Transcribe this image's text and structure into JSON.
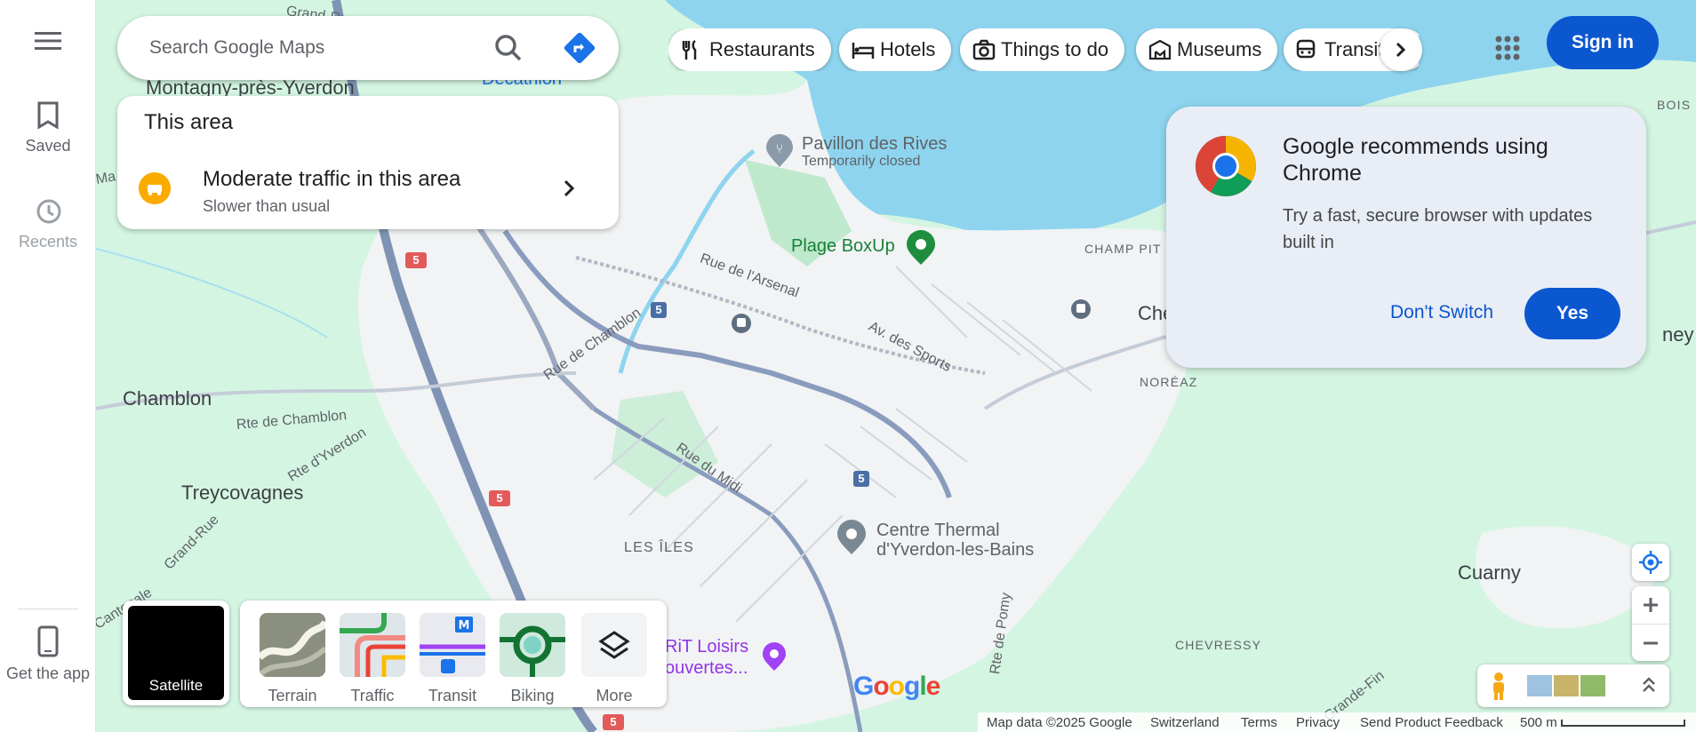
{
  "rail": {
    "saved": "Saved",
    "recents": "Recents",
    "get_app": "Get the app"
  },
  "search": {
    "placeholder": "Search Google Maps"
  },
  "area_card": {
    "heading": "This area",
    "traffic_title": "Moderate traffic in this area",
    "traffic_sub": "Slower than usual"
  },
  "chips": [
    {
      "label": "Restaurants",
      "icon": "fork-knife-icon"
    },
    {
      "label": "Hotels",
      "icon": "bed-icon"
    },
    {
      "label": "Things to do",
      "icon": "camera-icon"
    },
    {
      "label": "Museums",
      "icon": "museum-icon"
    },
    {
      "label": "Transit",
      "icon": "train-icon"
    }
  ],
  "sign_in": "Sign in",
  "promo": {
    "title": "Google recommends using Chrome",
    "body": "Try a fast, secure browser with updates built in",
    "dont_switch": "Don't Switch",
    "yes": "Yes"
  },
  "layers": {
    "satellite": "Satellite",
    "terrain": "Terrain",
    "traffic": "Traffic",
    "transit": "Transit",
    "biking": "Biking",
    "more": "More"
  },
  "map_labels": {
    "grand_rue_top": "Grand-Rue",
    "montagny": "Montagny-près-Yverdon",
    "decathlon": "Decathlon",
    "chamblon": "Chamblon",
    "treycovagnes": "Treycovagnes",
    "les_iles": "LES ÎLES",
    "noreaz": "NORÉAZ",
    "champ_pit": "CHAMP PIT",
    "che": "Che",
    "ney": "ney",
    "bois_c": "BOIS C",
    "cuarny": "Cuarny",
    "chevressy": "CHEVRESSY",
    "pavillon": "Pavillon des Rives",
    "pavillon_sub": "Temporarily closed",
    "plage": "Plage BoxUp",
    "centre_thermal_1": "Centre Thermal",
    "centre_thermal_2": "d'Yverdon-les-Bains",
    "rit_1": "RiT Loisirs",
    "rit_2": "ouvertes...",
    "rue_arsenal": "Rue de l'Arsenal",
    "rue_chamblon": "Rue de Chamblon",
    "av_sports": "Av. des Sports",
    "rue_midi": "Rue du Midi",
    "rte_chamblon": "Rte de Chamblon",
    "rte_yverdon": "Rte d'Yverdon",
    "grand_rue": "Grand-Rue",
    "cantonale": "Cantonale",
    "rte_pomy": "Rte de Pomy",
    "grande_fin": "Grande-Fin",
    "route_5": "5",
    "ma": "Ma"
  },
  "google_logo": "Google",
  "footer": {
    "mapdata": "Map data ©2025 Google",
    "country": "Switzerland",
    "terms": "Terms",
    "privacy": "Privacy",
    "feedback": "Send Product Feedback",
    "scale": "500 m"
  },
  "colors": {
    "water": "#8ed4ee",
    "land": "#d4f5e2",
    "urban": "#f1f3f4",
    "accent": "#0b57d0",
    "traffic_yellow": "#f9ab00"
  }
}
